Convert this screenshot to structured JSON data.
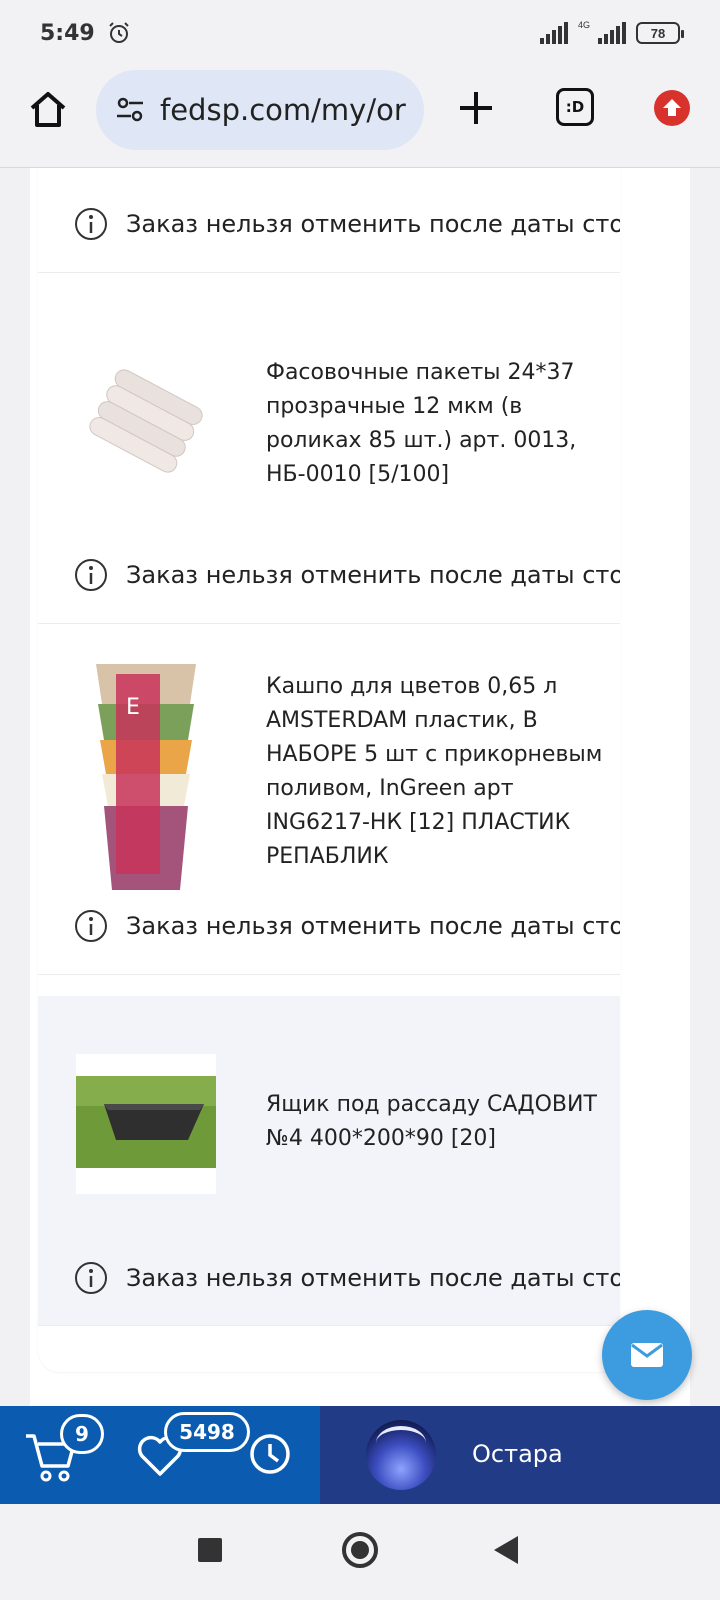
{
  "status_bar": {
    "time": "5:49",
    "network_type": "4G",
    "battery": "78"
  },
  "browser": {
    "url": "fedsp.com/my/or",
    "tabs_label": ":D"
  },
  "order_items": [
    {
      "title": "",
      "notice": "Заказ нельзя отменить после даты стопа"
    },
    {
      "title": "Фасовочные пакеты 24*37 прозрачные 12 мкм (в роликах 85 шт.) арт. 0013, НБ-0010 [5/100]",
      "notice": "Заказ нельзя отменить после даты стопа",
      "image": "plastic-bag-rolls"
    },
    {
      "title": "Кашпо для цветов 0,65 л AMSTERDAM пластик, В НАБОРЕ 5 шт с прикорневым поливом, InGreen арт ING6217-НК [12] ПЛАСТИК РЕПАБЛИК",
      "notice": "Заказ нельзя отменить после даты стопа",
      "image": "flower-pots-set"
    },
    {
      "title": "Ящик под рассаду САДОВИТ №4 400*200*90 [20]",
      "notice": "Заказ нельзя отменить после даты стопа",
      "image": "seedling-box"
    }
  ],
  "bottom_bar": {
    "cart_count": "9",
    "favorites_count": "5498",
    "user_name": "Остара"
  },
  "colors": {
    "bottom_left": "#0b5cb0",
    "bottom_right": "#213b87",
    "fab": "#3d9be0",
    "update": "#d8322d"
  }
}
